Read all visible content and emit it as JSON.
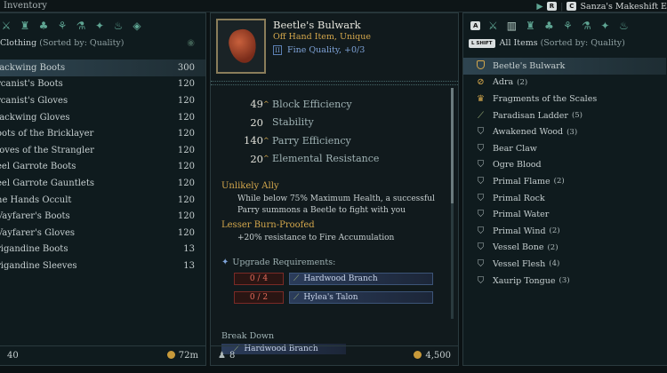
{
  "header": {
    "title": "Inventory",
    "key_r": "R",
    "key_c": "C",
    "companion": "Sanza's Makeshift E"
  },
  "left": {
    "category": "Clothing",
    "sort": "(Sorted by: Quality)",
    "items": [
      {
        "name": "lackwing Boots",
        "value": "300"
      },
      {
        "name": "rcanist's Boots",
        "value": "120"
      },
      {
        "name": "rcanist's Gloves",
        "value": "120"
      },
      {
        "name": "lackwing Gloves",
        "value": "120"
      },
      {
        "name": "oots of the Bricklayer",
        "value": "120"
      },
      {
        "name": "loves of the Strangler",
        "value": "120"
      },
      {
        "name": "eel Garrote Boots",
        "value": "120"
      },
      {
        "name": "eel Garrote Gauntlets",
        "value": "120"
      },
      {
        "name": "he Hands Occult",
        "value": "120"
      },
      {
        "name": "Vayfarer's Boots",
        "value": "120"
      },
      {
        "name": "Vayfarer's Gloves",
        "value": "120"
      },
      {
        "name": "rigandine Boots",
        "value": "13"
      },
      {
        "name": "rigandine Sleeves",
        "value": "13"
      }
    ],
    "footer_left": "40",
    "footer_right": "72m"
  },
  "item": {
    "name": "Beetle's Bulwark",
    "type": "Off Hand Item, Unique",
    "quality": "Fine Quality, +0/3",
    "stats": [
      {
        "value": "49",
        "label": "Parry Efficiency",
        "up": true
      },
      {
        "value": "20",
        "label": "Stability",
        "up": false
      },
      {
        "value": "140",
        "label": "Parry Efficiency",
        "up": true
      },
      {
        "value": "20",
        "label": "Elemental Resistance",
        "up": true
      }
    ],
    "stat0_label": "Block Efficiency",
    "abilities": [
      {
        "title": "Unlikely Ally",
        "text": "While below 75% Maximum Health, a successful Parry summons a Beetle to fight with you"
      },
      {
        "title": "Lesser Burn-Proofed",
        "text": "+20% resistance to Fire Accumulation"
      }
    ],
    "upgrade_title": "Upgrade Requirements:",
    "requirements": [
      {
        "count": "0 / 4",
        "material": "Hardwood Branch"
      },
      {
        "count": "0 / 2",
        "material": "Hylea's Talon"
      }
    ],
    "breakdown_title": "Break Down",
    "breakdown_material": "Hardwood Branch",
    "footer_left": "8",
    "footer_right": "4,500"
  },
  "right": {
    "shift_key": "L SHIFT",
    "heading": "All Items",
    "sort": "(Sorted by: Quality)",
    "items": [
      {
        "name": "Beetle's Bulwark",
        "count": ""
      },
      {
        "name": "Adra",
        "count": "(2)"
      },
      {
        "name": "Fragments of the Scales",
        "count": ""
      },
      {
        "name": "Paradisan Ladder",
        "count": "(5)"
      },
      {
        "name": "Awakened Wood",
        "count": "(3)"
      },
      {
        "name": "Bear Claw",
        "count": ""
      },
      {
        "name": "Ogre Blood",
        "count": ""
      },
      {
        "name": "Primal Flame",
        "count": "(2)"
      },
      {
        "name": "Primal Rock",
        "count": ""
      },
      {
        "name": "Primal Water",
        "count": ""
      },
      {
        "name": "Primal Wind",
        "count": "(2)"
      },
      {
        "name": "Vessel Bone",
        "count": "(2)"
      },
      {
        "name": "Vessel Flesh",
        "count": "(4)"
      },
      {
        "name": "Xaurip Tongue",
        "count": "(3)"
      }
    ]
  }
}
